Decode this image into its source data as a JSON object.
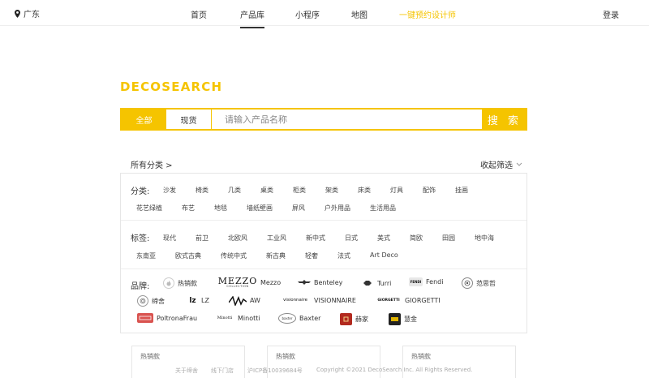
{
  "header": {
    "location": "广东",
    "nav": [
      {
        "label": "首页"
      },
      {
        "label": "产品库"
      },
      {
        "label": "小程序"
      },
      {
        "label": "地图"
      },
      {
        "label": "一键预约设计师"
      }
    ],
    "login": "登录",
    "accent_color": "#f5c400"
  },
  "logo": "DECOSEARCH",
  "search": {
    "tabs": [
      {
        "label": "全部"
      },
      {
        "label": "现货"
      }
    ],
    "placeholder": "请输入产品名称",
    "button": "搜 索"
  },
  "filters": {
    "all_label": "所有分类 >",
    "collapse_label": "收起筛选",
    "category": {
      "label": "分类:",
      "items": [
        "沙发",
        "椅类",
        "几类",
        "桌类",
        "柜类",
        "架类",
        "床类",
        "灯具",
        "配饰",
        "挂画",
        "花艺绿植",
        "布艺",
        "地毯",
        "墙纸壁画",
        "屏风",
        "户外用品",
        "生活用品"
      ]
    },
    "tags": {
      "label": "标签:",
      "items": [
        "现代",
        "前卫",
        "北欧风",
        "工业风",
        "新中式",
        "日式",
        "美式",
        "简欧",
        "田园",
        "地中海",
        "东南亚",
        "欧式古典",
        "传统中式",
        "新古典",
        "轻奢",
        "法式",
        "Art Deco"
      ]
    },
    "brands": {
      "label": "品牌:",
      "items": [
        {
          "name": "热销款",
          "icon": "hot-icon"
        },
        {
          "name": "Mezzo",
          "icon": "mezzo-logo",
          "logo_text": "MEZZO",
          "logo_sub": "COLLECTION"
        },
        {
          "name": "Benteley",
          "icon": "benteley-logo"
        },
        {
          "name": "Turri",
          "icon": "turri-logo"
        },
        {
          "name": "Fendi",
          "icon": "fendi-logo",
          "logo_text": "FENDI"
        },
        {
          "name": "范思哲",
          "icon": "versace-logo"
        },
        {
          "name": "缔舍",
          "icon": "dishe-logo"
        },
        {
          "name": "LZ",
          "icon": "lz-logo",
          "logo_text": "lz"
        },
        {
          "name": "AW",
          "icon": "aw-logo"
        },
        {
          "name": "VISIONNAIRE",
          "icon": "visionnaire-logo",
          "logo_text": "visionnaire"
        },
        {
          "name": "GIORGETTI",
          "icon": "giorgetti-logo",
          "logo_text": "GIORGETTI"
        },
        {
          "name": "PoltronaFrau",
          "icon": "poltronafrau-logo"
        },
        {
          "name": "Minotti",
          "icon": "minotti-logo",
          "logo_text": "Minotti"
        },
        {
          "name": "Baxter",
          "icon": "baxter-logo",
          "logo_text": "baxter"
        },
        {
          "name": "赫家",
          "icon": "hejia-logo"
        },
        {
          "name": "慧金",
          "icon": "huijin-logo"
        }
      ]
    }
  },
  "cards": [
    {
      "title": "热销款"
    },
    {
      "title": "热销款"
    },
    {
      "title": "热销款"
    }
  ],
  "footer": {
    "links": [
      "关于缔舍",
      "线下门店",
      "沪ICP备10039684号"
    ],
    "copyright": "Copyright ©2021 DecoSearch Inc. All Rights Reserved."
  }
}
